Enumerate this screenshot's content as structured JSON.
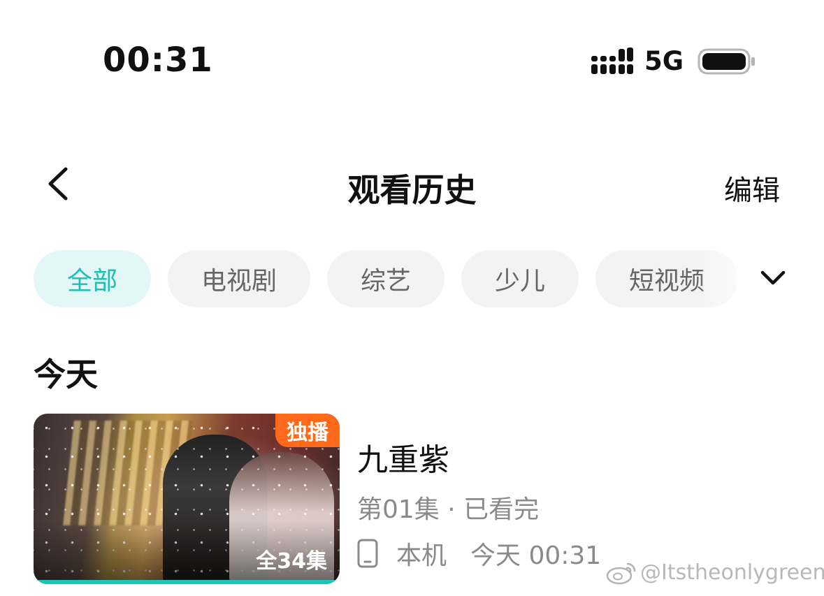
{
  "status_bar": {
    "time": "00:31",
    "network": "5G",
    "signal_icon": "signal-bars-icon",
    "battery_icon": "battery-icon"
  },
  "nav": {
    "title": "观看历史",
    "edit_label": "编辑",
    "back_icon": "chevron-left-icon"
  },
  "filters": {
    "chips": [
      "全部",
      "电视剧",
      "综艺",
      "少儿",
      "短视频"
    ],
    "active": "全部",
    "more_icon": "chevron-down-icon"
  },
  "sections": [
    {
      "heading": "今天",
      "items": [
        {
          "title": "九重紫",
          "badge": "独播",
          "episodes_total": "全34集",
          "progress_text": "第01集 · 已看完",
          "device": "本机",
          "watched_at": "今天 00:31",
          "progress": 1.0
        }
      ]
    }
  ],
  "colors": {
    "accent": "#17c1b4",
    "badge": "#ff6a1a",
    "chip_bg": "#f3f3f3",
    "chip_active_bg": "#e2f7f6"
  },
  "watermark": "@Itstheonlygreen"
}
